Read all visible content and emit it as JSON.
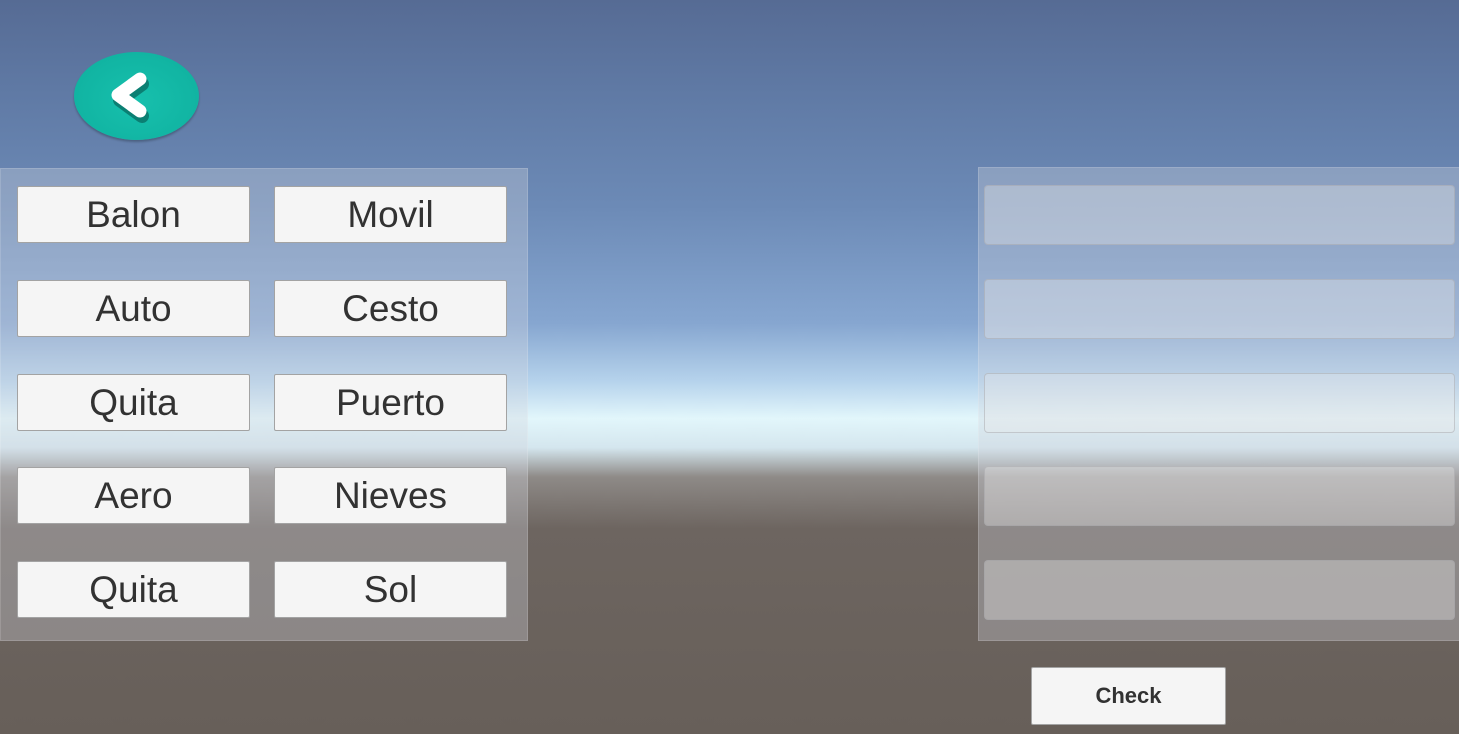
{
  "back_button": {
    "icon": "chevron-left-icon",
    "color": "#13b8a6"
  },
  "words": [
    {
      "label": "Balon"
    },
    {
      "label": "Movil"
    },
    {
      "label": "Auto"
    },
    {
      "label": "Cesto"
    },
    {
      "label": "Quita"
    },
    {
      "label": "Puerto"
    },
    {
      "label": "Aero"
    },
    {
      "label": "Nieves"
    },
    {
      "label": "Quita"
    },
    {
      "label": "Sol"
    }
  ],
  "answer_slots": [
    "",
    "",
    "",
    "",
    ""
  ],
  "check_button": {
    "label": "Check"
  }
}
